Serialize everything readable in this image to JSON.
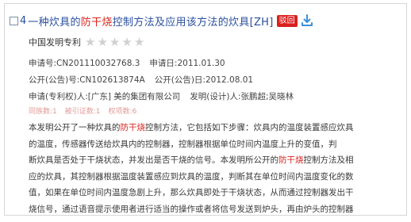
{
  "result": {
    "index": "4",
    "title_parts": [
      "一种炊具的",
      "防干烧",
      "控制方法及应用该方法的炊具[ZH]"
    ],
    "badge": "驳回",
    "type": "中国发明专利",
    "rating": 0,
    "application_no": "申请号:CN201110032768.3",
    "application_date": "申请日:2011.01.30",
    "publication_no": "公开(公告)号:CN102613874A",
    "publication_date": "公开(公告)日:2012.08.01",
    "applicant": "申请(专利权)人:[广东] 美的集团有限公司",
    "inventor": "发明(设计)人:张鹏超;吴晓林",
    "stats": [
      "同族数:1",
      "被引证数:1",
      "权项数:6"
    ],
    "abstract_lines": [
      [
        "本发明公开了一种炊具的",
        "防干烧",
        "控制方法，它包括如下步骤：炊具内的温度装置感应炊具"
      ],
      [
        "的温度，传感器传送给炊具内的控制器，控制器根据单位时间内温度上升的变值，判"
      ],
      [
        "断炊具是否处于干烧状态，并发出是否干烧的信号。本发明所公开的",
        "防干烧",
        "控制方法及相"
      ],
      [
        "应的炊具，其控制器根据温度装置感应到炊具的温度，判断其在单位时间内温度变化的数"
      ],
      [
        "值，如果在单位时间内温度急剧上升，那么炊具即处于干烧状态，从而通过控制器发出干"
      ],
      [
        "烧信号，通过语音提示使用者进行适当的操作或者将信号发送到炉头，再由炉头的控制器"
      ]
    ]
  },
  "colors": {
    "title_blue": "#2a4f9e",
    "highlight_red": "#d8241e",
    "badge_red": "#d8201e",
    "stats_pink": "#e29a96",
    "download_blue": "#3c8ed8"
  },
  "icons": [
    "checkbox-icon",
    "star-icon",
    "download-icon"
  ]
}
